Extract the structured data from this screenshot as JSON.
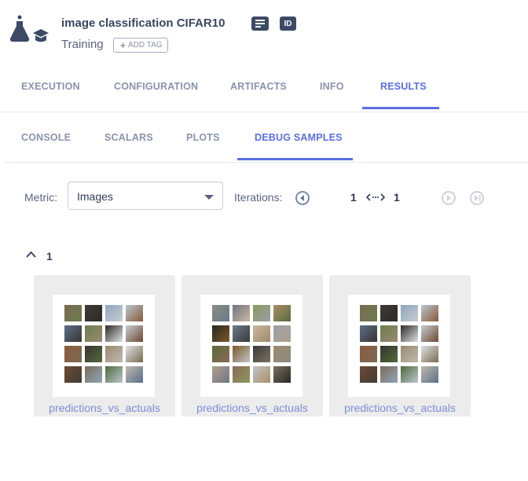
{
  "header": {
    "title": "image classification CIFAR10",
    "status": "Training",
    "add_tag": "ADD TAG",
    "id_badge": "ID",
    "icons": [
      "experiment-icon",
      "description-icon",
      "id-icon"
    ]
  },
  "main_tabs": [
    {
      "label": "EXECUTION",
      "active": false
    },
    {
      "label": "CONFIGURATION",
      "active": false
    },
    {
      "label": "ARTIFACTS",
      "active": false
    },
    {
      "label": "INFO",
      "active": false
    },
    {
      "label": "RESULTS",
      "active": true
    }
  ],
  "sub_tabs": [
    {
      "label": "CONSOLE",
      "active": false
    },
    {
      "label": "SCALARS",
      "active": false
    },
    {
      "label": "PLOTS",
      "active": false
    },
    {
      "label": "DEBUG SAMPLES",
      "active": true
    }
  ],
  "controls": {
    "metric_label": "Metric:",
    "metric_value": "Images",
    "iterations_label": "Iterations:",
    "iteration_from": "1",
    "iteration_to": "1"
  },
  "group": {
    "title": "1",
    "samples": [
      {
        "label": "predictions_vs_actuals"
      },
      {
        "label": "predictions_vs_actuals"
      },
      {
        "label": "predictions_vs_actuals"
      }
    ]
  },
  "colors": {
    "accent": "#5a6ee8",
    "text_dark": "#3b4660",
    "card_bg": "#ececec"
  }
}
